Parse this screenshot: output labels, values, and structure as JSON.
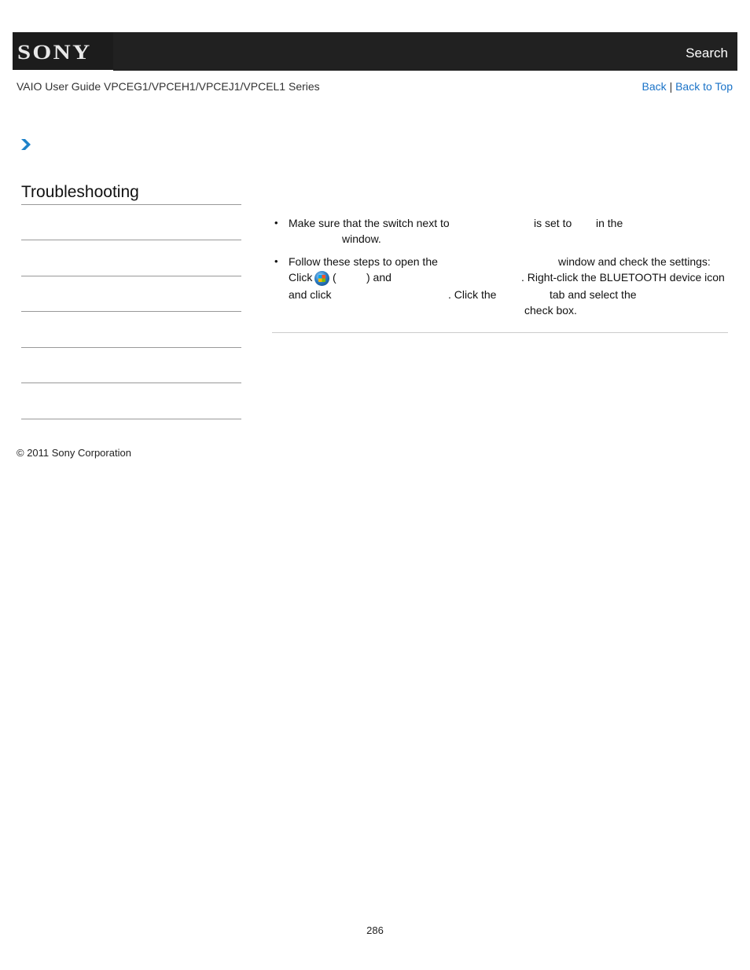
{
  "header": {
    "logo_text": "SONY",
    "search_label": "Search"
  },
  "subheader": {
    "guide_title": "VAIO User Guide VPCEG1/VPCEH1/VPCEJ1/VPCEL1 Series",
    "back_label": "Back",
    "separator": "|",
    "back_to_top_label": "Back to Top"
  },
  "breadcrumb": {
    "icon": "chevron-right-icon"
  },
  "sidebar": {
    "section_title": "Troubleshooting",
    "items": [
      "",
      "",
      "",
      "",
      "",
      ""
    ]
  },
  "content": {
    "bullets": [
      {
        "lines": [
          [
            "Make sure that the switch next to",
            "is set to",
            "in the"
          ],
          [
            "window."
          ]
        ]
      },
      {
        "lines": [
          [
            "Follow these steps to open the",
            "window and check the settings:"
          ],
          [
            "Click",
            "(",
            ") and",
            ". Right-click the BLUETOOTH device icon"
          ],
          [
            "and click",
            ". Click the",
            "tab and select the"
          ],
          [
            "check box."
          ]
        ]
      }
    ],
    "start_icon": "windows-start-icon"
  },
  "footer": {
    "copyright": "© 2011 Sony Corporation",
    "page_number": "286"
  }
}
